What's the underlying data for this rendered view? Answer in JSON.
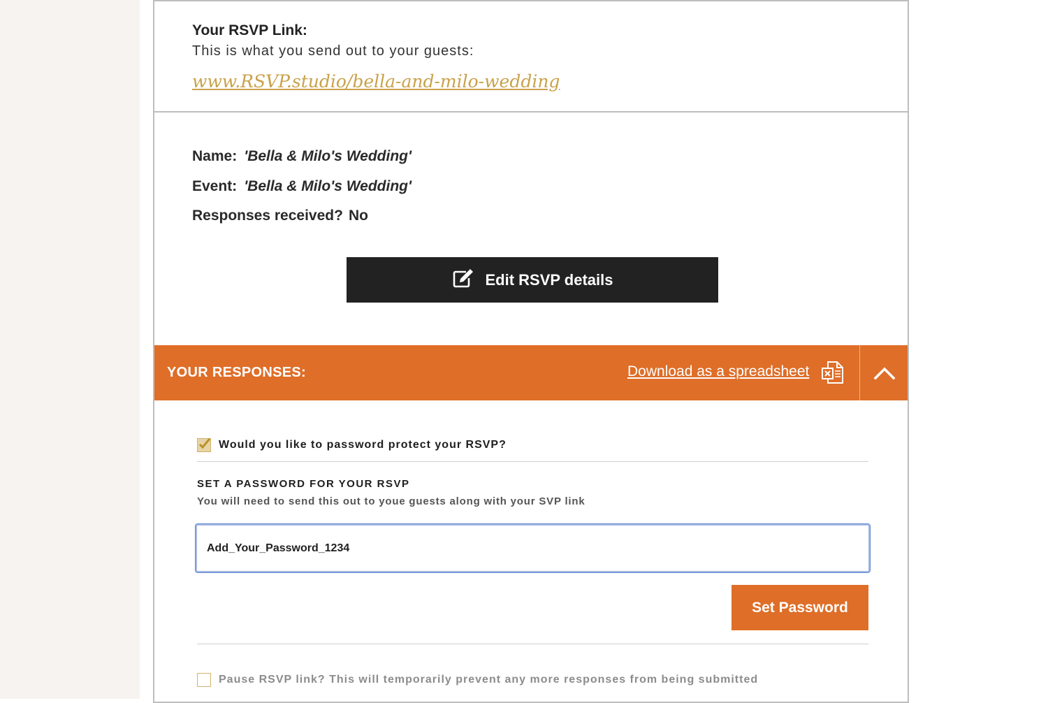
{
  "rsvp_link": {
    "title": "Your RSVP Link:",
    "subtitle": "This is what you send out to your guests:",
    "url": "www.RSVP.studio/bella-and-milo-wedding"
  },
  "details": {
    "name_label": "Name:",
    "name_value": "'Bella & Milo's Wedding'",
    "event_label": "Event:",
    "event_value": "'Bella & Milo's Wedding'",
    "responses_label": "Responses received?",
    "responses_value": "No",
    "edit_button": "Edit RSVP details"
  },
  "responses_bar": {
    "title": "YOUR RESPONSES:",
    "download_link": "Download as a spreadsheet"
  },
  "password": {
    "protect_question": "Would you like to password protect your RSVP?",
    "protect_checked": true,
    "set_title": "SET A PASSWORD FOR YOUR RSVP",
    "set_subtitle": "You will need to send this out to youe guests along with your SVP link",
    "input_value": "Add_Your_Password_1234",
    "set_button": "Set Password"
  },
  "pause": {
    "label": "Pause RSVP link? This will temporarily prevent any more responses from being submitted",
    "checked": false
  },
  "colors": {
    "accent_orange": "#df6e28",
    "gold": "#c9a24a",
    "dark_button": "#222222",
    "side_background": "#f7f3f0"
  }
}
